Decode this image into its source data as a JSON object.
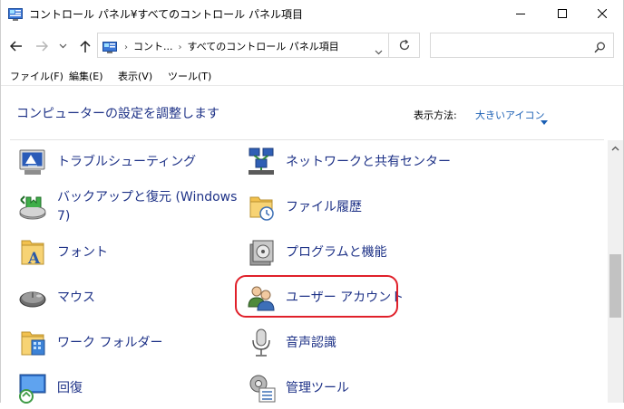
{
  "window": {
    "title": "コントロール パネル¥すべてのコントロール パネル項目"
  },
  "address": {
    "segments": [
      "コント...",
      "すべてのコントロール パネル項目"
    ],
    "search_placeholder": ""
  },
  "menu": {
    "items": [
      "ファイル(F)",
      "編集(E)",
      "表示(V)",
      "ツール(T)"
    ]
  },
  "content": {
    "title": "コンピューターの設定を調整します",
    "view_by_label": "表示方法:",
    "view_by_value": "大きいアイコン"
  },
  "items": [
    {
      "label": "トラブルシューティング",
      "icon": "troubleshooting-icon"
    },
    {
      "label": "ネットワークと共有センター",
      "icon": "network-icon"
    },
    {
      "label": "バックアップと復元 (Windows 7)",
      "icon": "backup-icon"
    },
    {
      "label": "ファイル履歴",
      "icon": "file-history-icon"
    },
    {
      "label": "フォント",
      "icon": "fonts-icon"
    },
    {
      "label": "プログラムと機能",
      "icon": "programs-icon"
    },
    {
      "label": "マウス",
      "icon": "mouse-icon"
    },
    {
      "label": "ユーザー アカウント",
      "icon": "user-accounts-icon"
    },
    {
      "label": "ワーク フォルダー",
      "icon": "work-folders-icon"
    },
    {
      "label": "音声認識",
      "icon": "microphone-icon"
    },
    {
      "label": "回復",
      "icon": "recovery-icon"
    },
    {
      "label": "管理ツール",
      "icon": "admin-tools-icon"
    }
  ],
  "colors": {
    "link": "#1e3287",
    "accent": "#1a5fb4",
    "highlight": "#e0202a"
  }
}
